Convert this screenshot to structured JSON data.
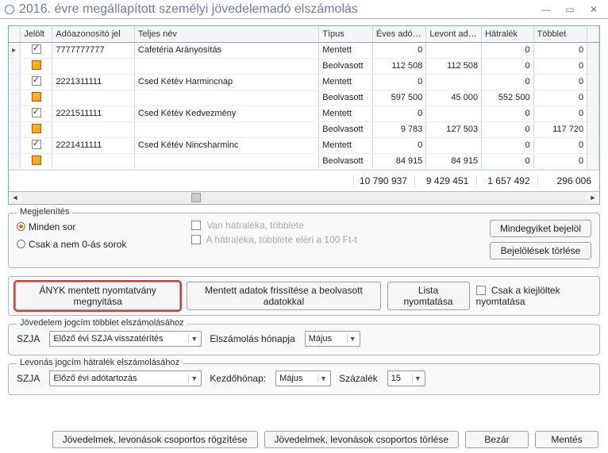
{
  "window": {
    "title": "2016. évre megállapított személyi jövedelemadó elszámolás"
  },
  "grid": {
    "headers": {
      "handle": "",
      "jelolt": "Jelölt",
      "ado": "Adóazonosító jel",
      "nev": "Teljes név",
      "tipus": "Típus",
      "eves": "Éves adókot.",
      "levont": "Levont adóe.",
      "hatralek": "Hátralék",
      "tobblet": "Többlet"
    },
    "rows": [
      {
        "ptr": true,
        "chk": "checked",
        "ado": "7777777777",
        "nev": "Cafetéria Arányosítás",
        "tipus": "Mentett",
        "eves": "0",
        "lev": "",
        "hat": "0",
        "tob": "0"
      },
      {
        "ptr": false,
        "chk": "square",
        "ado": "",
        "nev": "",
        "tipus": "Beolvasott",
        "eves": "112 508",
        "lev": "112 508",
        "hat": "0",
        "tob": "0"
      },
      {
        "ptr": false,
        "chk": "checked",
        "ado": "2221311111",
        "nev": "Csed Kétév Harmincnap",
        "tipus": "Mentett",
        "eves": "0",
        "lev": "",
        "hat": "0",
        "tob": "0"
      },
      {
        "ptr": false,
        "chk": "square",
        "ado": "",
        "nev": "",
        "tipus": "Beolvasott",
        "eves": "597 500",
        "lev": "45 000",
        "hat": "552 500",
        "tob": "0"
      },
      {
        "ptr": false,
        "chk": "checked",
        "ado": "2221511111",
        "nev": "Csed Kétév Kedvezmény",
        "tipus": "Mentett",
        "eves": "0",
        "lev": "",
        "hat": "0",
        "tob": "0"
      },
      {
        "ptr": false,
        "chk": "square",
        "ado": "",
        "nev": "",
        "tipus": "Beolvasott",
        "eves": "9 783",
        "lev": "127 503",
        "hat": "0",
        "tob": "117 720"
      },
      {
        "ptr": false,
        "chk": "checked",
        "ado": "2221411111",
        "nev": "Csed Kétév Nincsharminc",
        "tipus": "Mentett",
        "eves": "0",
        "lev": "",
        "hat": "0",
        "tob": "0"
      },
      {
        "ptr": false,
        "chk": "square",
        "ado": "",
        "nev": "",
        "tipus": "Beolvasott",
        "eves": "84 915",
        "lev": "84 915",
        "hat": "0",
        "tob": "0"
      }
    ],
    "totals": {
      "eves": "10 790 937",
      "lev": "9 429 451",
      "hat": "1 657 492",
      "tob": "296 006"
    }
  },
  "display": {
    "title": "Megjelenítés",
    "radio_all": "Minden sor",
    "radio_nonzero": "Csak a nem 0-ás sorok",
    "chk_has_diff": "Van hátraléka, többlete",
    "chk_over_100": "A hátraléka, többlete eléri a 100 Ft-t",
    "btn_select_all": "Mindegyiket bejelöl",
    "btn_clear_sel": "Bejelölések törlése"
  },
  "actions": {
    "open_anyk": "ÁNYK mentett nyomtatvány megnyitása",
    "refresh": "Mentett adatok frissítése a beolvasott adatokkal",
    "print_list": "Lista nyomtatása",
    "only_selected": "Csak a kiejlöltek nyomtatása"
  },
  "section_topup": {
    "title": "Jövedelem jogcím többlet elszámolásához",
    "label_szja": "SZJA",
    "szja_value": "Előző évi SZJA visszatérítés",
    "label_month": "Elszámolás hónapja",
    "month_value": "Május"
  },
  "section_deduct": {
    "title": "Levonás jogcím hátralék elszámolásához",
    "label_szja": "SZJA",
    "szja_value": "Előző évi adótartozás",
    "label_start": "Kezdőhónap:",
    "month_value": "Május",
    "label_pct": "Százalék",
    "pct_value": "15"
  },
  "footer": {
    "group_add": "Jövedelmek, levonások csoportos rögzítése",
    "group_del": "Jövedelmek, levonások csoportos törlése",
    "close": "Bezár",
    "save": "Mentés"
  }
}
